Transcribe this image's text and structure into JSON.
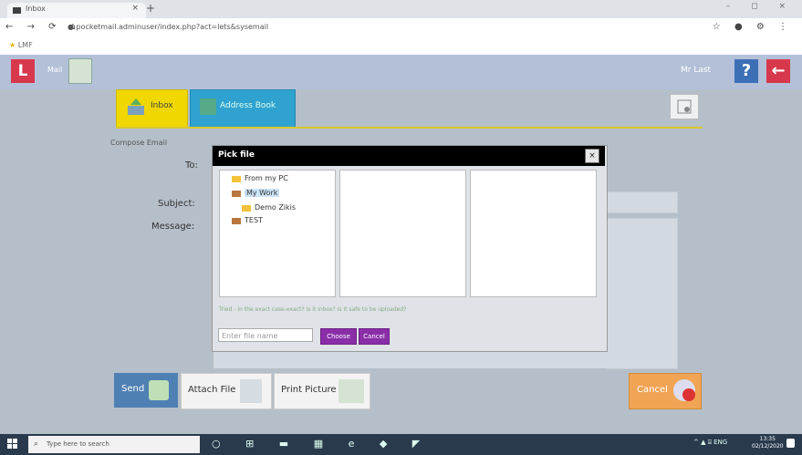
{
  "browser": {
    "tab_title": "Inbox",
    "tab_close": "×",
    "new_tab": "+",
    "window_controls": "– ◻ ×",
    "nav_icons": "← → ⟳ ⌂",
    "url": "● pocketmail.adminuser/index.php?act=lets&sysemail",
    "right_icons": "☆ ● ⚙ ⋮",
    "bookmark_icon": "★",
    "bookmark_label": "LMF"
  },
  "app_header": {
    "logo_letter": "L",
    "label": "Mail",
    "username": "Mr Last",
    "help_label": "?",
    "back_label": "←",
    "colors": {
      "header_bg": "#b3c0d8",
      "logo_red": "#d8384c",
      "help_blue": "#3d6fb7"
    }
  },
  "tabs": [
    {
      "label": "Inbox",
      "icon": "inbox-icon",
      "color": "#f0d700"
    },
    {
      "label": "Address Book",
      "icon": "address-book-icon",
      "color": "#30a2d0"
    }
  ],
  "compose": {
    "heading": "Compose Email",
    "to_label": "To:",
    "subject_label": "Subject:",
    "message_label": "Message:"
  },
  "dialog": {
    "title": "Pick file",
    "close_label": "×",
    "tree": [
      {
        "label": "From my PC",
        "icon": "folder-icon",
        "selected": false
      },
      {
        "label": "My Work",
        "icon": "folder-icon",
        "selected": true
      },
      {
        "label": "Demo Zikis",
        "icon": "folder-icon",
        "selected": false
      },
      {
        "label": "TEST",
        "icon": "folder-brown-icon",
        "selected": false
      }
    ],
    "hint": "Tried - in the exact case-exact? Is it Inbox? Is it safe to be uploaded?",
    "filename_placeholder": "Enter file name",
    "choose_label": "Choose",
    "cancel_label": "Cancel",
    "button_color": "#8a2ea8"
  },
  "actions": {
    "send_label": "Send",
    "attach_label": "Attach File",
    "print_label": "Print Picture",
    "cancel_label": "Cancel"
  },
  "taskbar": {
    "search_placeholder": "Type here to search",
    "search_icon": "⌕",
    "icons": "○ ⊞ ▬ ▦ e ◆ ◤",
    "tray": "^ ▲ ⌸ ENG",
    "time": "13:35",
    "date": "02/12/2020"
  }
}
